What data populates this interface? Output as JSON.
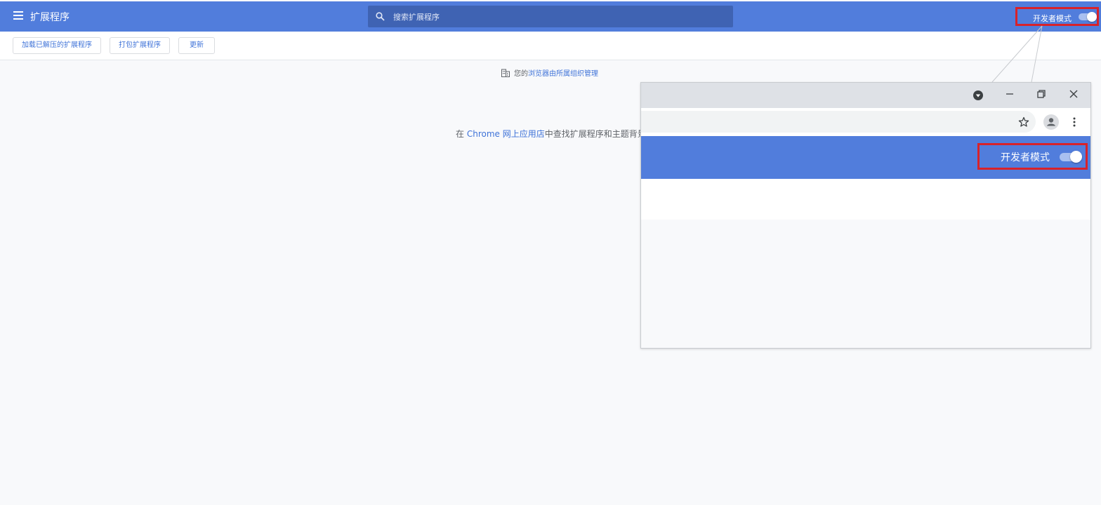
{
  "header": {
    "title": "扩展程序",
    "search_placeholder": "搜索扩展程序",
    "dev_mode_label": "开发者模式",
    "dev_mode_on": true,
    "accent_color": "#517ddc",
    "highlight_color": "#d8222a"
  },
  "toolbar": {
    "load_unpacked": "加载已解压的扩展程序",
    "pack_extension": "打包扩展程序",
    "update": "更新"
  },
  "org_notice": {
    "prefix": "您的",
    "link": "浏览器由所属组织管理"
  },
  "store_notice": {
    "prefix": "在 ",
    "link": "Chrome 网上应用店",
    "suffix": "中查找扩展程序和主题背景"
  },
  "inset": {
    "dev_mode_label": "开发者模式",
    "dev_mode_on": true,
    "icons": [
      "profile-dropdown-icon",
      "minimize-icon",
      "restore-icon",
      "close-icon",
      "star-icon",
      "account-icon",
      "more-vert-icon"
    ]
  }
}
